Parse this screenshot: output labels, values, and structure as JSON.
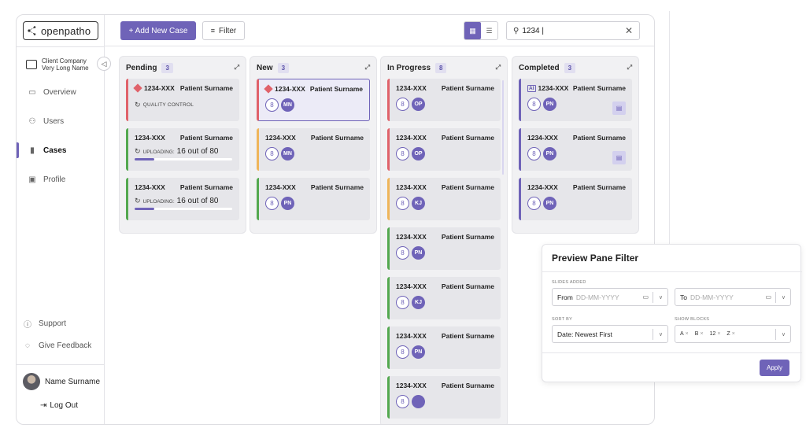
{
  "brand": {
    "name": "openpatho"
  },
  "sidebar": {
    "client": "Client Company Very Long Name",
    "items": [
      {
        "label": "Overview",
        "icon": "inbox-icon"
      },
      {
        "label": "Users",
        "icon": "users-icon"
      },
      {
        "label": "Cases",
        "icon": "file-icon",
        "active": true
      },
      {
        "label": "Profile",
        "icon": "id-card-icon"
      }
    ],
    "support": "Support",
    "feedback": "Give Feedback",
    "user_name": "Name Surname",
    "logout": "Log Out"
  },
  "toolbar": {
    "add_label": "+ Add New Case",
    "filter_label": "Filter",
    "search_value": "1234 |"
  },
  "columns": [
    {
      "title": "Pending",
      "count": "3",
      "cards": [
        {
          "id": "1234-XXX",
          "name": "Patient Surname",
          "status": "QUALITY CONTROL"
        },
        {
          "id": "1234-XXX",
          "name": "Patient Surname",
          "upload_label": "UPLOADING:",
          "upload_text": "16 out of 80",
          "progress": 0.2
        },
        {
          "id": "1234-XXX",
          "name": "Patient Surname",
          "upload_label": "UPLOADING:",
          "upload_text": "16 out of 80",
          "progress": 0.2
        }
      ]
    },
    {
      "title": "New",
      "count": "3",
      "cards": [
        {
          "id": "1234-XXX",
          "name": "Patient Surname",
          "num": "8",
          "initials": "MN"
        },
        {
          "id": "1234-XXX",
          "name": "Patient Surname",
          "num": "8",
          "initials": "MN"
        },
        {
          "id": "1234-XXX",
          "name": "Patient Surname",
          "num": "8",
          "initials": "PN"
        }
      ]
    },
    {
      "title": "In Progress",
      "count": "8",
      "cards": [
        {
          "id": "1234-XXX",
          "name": "Patient Surname",
          "num": "8",
          "initials": "OP"
        },
        {
          "id": "1234-XXX",
          "name": "Patient Surname",
          "num": "8",
          "initials": "OP"
        },
        {
          "id": "1234-XXX",
          "name": "Patient Surname",
          "num": "8",
          "initials": "KJ"
        },
        {
          "id": "1234-XXX",
          "name": "Patient Surname",
          "num": "8",
          "initials": "PN"
        },
        {
          "id": "1234-XXX",
          "name": "Patient Surname",
          "num": "8",
          "initials": "KJ"
        },
        {
          "id": "1234-XXX",
          "name": "Patient Surname",
          "num": "8",
          "initials": "PN"
        },
        {
          "id": "1234-XXX",
          "name": "Patient Surname",
          "num": "8",
          "initials": ""
        }
      ]
    },
    {
      "title": "Completed",
      "count": "3",
      "cards": [
        {
          "id": "1234-XXX",
          "name": "Patient Surname",
          "num": "8",
          "initials": "PN",
          "ai": "AI"
        },
        {
          "id": "1234-XXX",
          "name": "Patient Surname",
          "num": "8",
          "initials": "PN"
        },
        {
          "id": "1234-XXX",
          "name": "Patient Surname",
          "num": "8",
          "initials": "PN"
        }
      ]
    }
  ],
  "preview_pane": {
    "title": "Preview Pane Filter",
    "slides_added_label": "SLIDES ADDED",
    "from_label": "From",
    "from_placeholder": "DD-MM-YYYY",
    "to_label": "To",
    "to_placeholder": "DD-MM-YYYY",
    "sort_label": "SORT BY",
    "sort_value": "Date: Newest First",
    "blocks_label": "SHOW BLOCKS",
    "blocks": [
      "A",
      "B",
      "12",
      "Z"
    ],
    "apply_label": "Apply"
  },
  "colors": {
    "accent": "#6f63b8",
    "red": "#e0626a",
    "green": "#53a84f",
    "orange": "#efb55a"
  }
}
